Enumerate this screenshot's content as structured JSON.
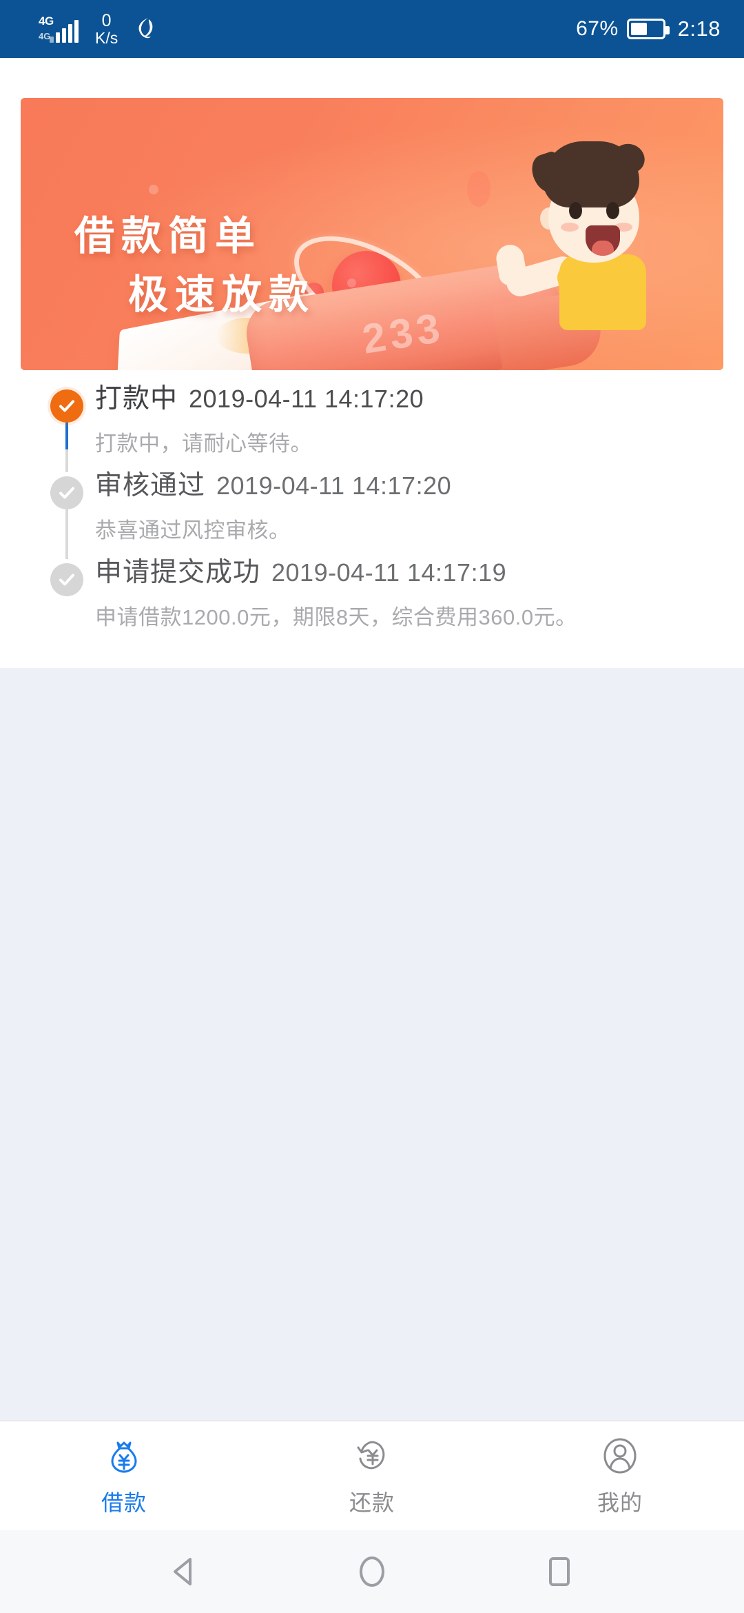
{
  "statusbar": {
    "network_generation": "4G",
    "network_generation_secondary": "4G",
    "speed_value": "0",
    "speed_unit": "K/s",
    "globe_icon": "globe-icon",
    "battery_percent": "67%",
    "clock": "2:18",
    "background_color": "#0b5394"
  },
  "banner": {
    "name": "loan-promo-banner",
    "headline_line1": "借款简单",
    "headline_line2": "极速放款",
    "rocket_number": "233",
    "background_color_start": "#f87a58",
    "background_color_end": "#fd9a66"
  },
  "timeline": {
    "accent_active_color": "#ef6c11",
    "progress_line_color": "#1f6fd0",
    "items": [
      {
        "status": "active",
        "title": "打款中",
        "time": "2019-04-11 14:17:20",
        "desc": "打款中，请耐心等待。"
      },
      {
        "status": "done",
        "title": "审核通过",
        "time": "2019-04-11 14:17:20",
        "desc": "恭喜通过风控审核。"
      },
      {
        "status": "done",
        "title": "申请提交成功",
        "time": "2019-04-11 14:17:19",
        "desc": "申请借款1200.0元，期限8天，综合费用360.0元。"
      }
    ]
  },
  "tabbar": {
    "active_color": "#1a7bed",
    "inactive_color": "#8a8c8e",
    "tabs": [
      {
        "label": "借款",
        "icon": "money-bag-icon",
        "active": true
      },
      {
        "label": "还款",
        "icon": "refresh-yen-icon",
        "active": false
      },
      {
        "label": "我的",
        "icon": "user-profile-icon",
        "active": false
      }
    ]
  },
  "navbar": {
    "back": "back-triangle-icon",
    "home": "home-circle-icon",
    "recents": "recents-square-icon"
  }
}
